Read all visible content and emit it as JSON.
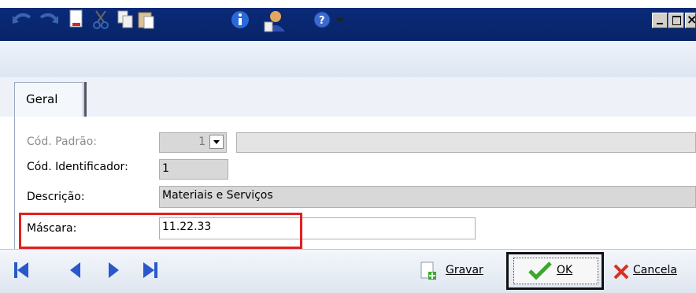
{
  "window": {
    "controls": {
      "minimize": "minimize",
      "maximize": "maximize",
      "close": "close"
    }
  },
  "toolbar": {
    "icons": [
      "undo-icon",
      "redo-icon",
      "new-document-icon",
      "cut-icon",
      "copy-icon",
      "paste-icon",
      "info-icon",
      "user-icon",
      "help-icon",
      "dropdown-arrow-icon"
    ]
  },
  "tabs": [
    {
      "label": "Geral",
      "active": true
    }
  ],
  "form": {
    "cod_padrao": {
      "label": "Cód. Padrão:",
      "value": "1",
      "disabled": true
    },
    "cod_identificador": {
      "label": "Cód. Identificador:",
      "value": "1"
    },
    "descricao": {
      "label": "Descrição:",
      "value": "Materiais e Serviços"
    },
    "mascara": {
      "label": "Máscara:",
      "value": "11.22.33"
    }
  },
  "actions": {
    "gravar": "Gravar",
    "ok": "OK",
    "cancela": "Cancela"
  },
  "colors": {
    "titlebar": "#0a2a78",
    "highlight": "#e02020",
    "ok_check": "#3aa82a",
    "cancel_x": "#d83020",
    "nav_arrows": "#2a58c8"
  }
}
